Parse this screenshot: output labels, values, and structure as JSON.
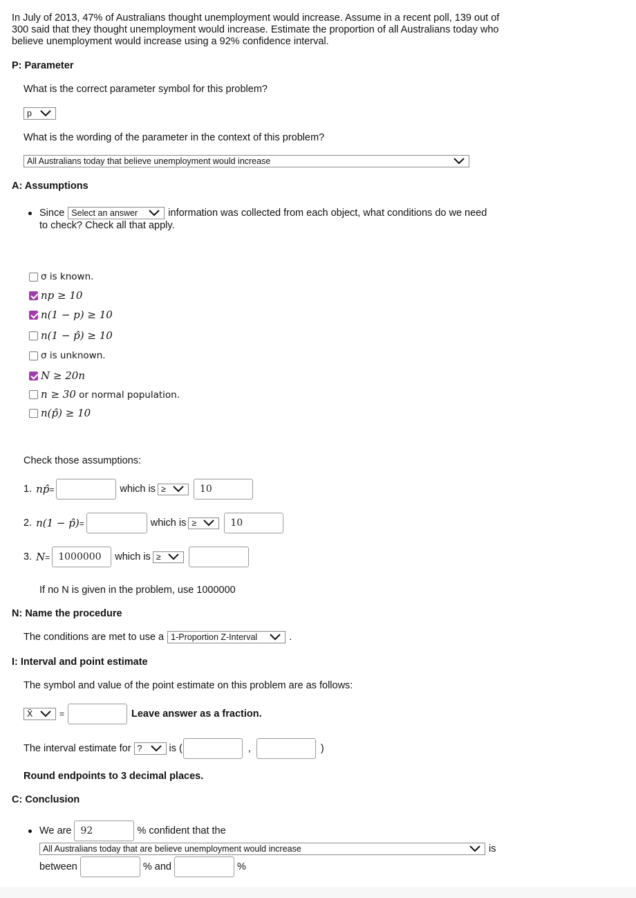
{
  "problem": {
    "text": "In July of 2013, 47% of Australians thought unemployment would increase.  Assume in a recent poll, 139 out of 300 said that they thought unemployment would increase.  Estimate the proportion of all Australians today who believe unemployment would increase using a 92% confidence interval."
  },
  "parameter": {
    "heading": "P: Parameter",
    "symbol_question": "What is the correct parameter symbol for this problem?",
    "symbol_value": "p",
    "wording_question": "What is the wording of the parameter in the context of this problem?",
    "wording_value": "All Australians today that believe unemployment would increase"
  },
  "assumptions": {
    "heading": "A: Assumptions",
    "since_prefix": "Since",
    "since_select": "Select an answer",
    "since_suffix": "information was collected from each object, what conditions do we need",
    "since_line2": "to check?  Check all that apply.",
    "options": [
      {
        "label": "σ is known.",
        "checked": false
      },
      {
        "label": "np ≥ 10",
        "checked": true
      },
      {
        "label": "n(1 − p) ≥ 10",
        "checked": true
      },
      {
        "label": "n(1 − p̂) ≥ 10",
        "checked": false
      },
      {
        "label": "σ is unknown.",
        "checked": false
      },
      {
        "label": "N ≥ 20n",
        "checked": true
      },
      {
        "label": "n ≥ 30 or normal population.",
        "checked": false
      },
      {
        "label": "n(p̂) ≥ 10",
        "checked": false
      }
    ],
    "check_heading": "Check those assumptions:",
    "checks": [
      {
        "num": "1.",
        "expr": "np̂=",
        "value": "",
        "which_is": "which is",
        "comparator": "≥",
        "compare_value": "10"
      },
      {
        "num": "2.",
        "expr": "n(1 − p̂)=",
        "value": "",
        "which_is": "which is",
        "comparator": "≥",
        "compare_value": "10"
      },
      {
        "num": "3.",
        "expr": "N=",
        "value": "1000000",
        "which_is": "which is",
        "comparator": "≥",
        "compare_value": ""
      }
    ],
    "n_note": "If no N is given in the problem, use 1000000"
  },
  "name": {
    "heading": "N: Name the procedure",
    "prefix": "The conditions are met to use a",
    "procedure": "1-Proportion Z-Interval",
    "suffix": "."
  },
  "interval": {
    "heading": "I: Interval and point estimate",
    "symbol_text": "The symbol and value of the point estimate on this problem are as follows:",
    "point_symbol": "X̄",
    "equals": "=",
    "point_value": "",
    "fraction_note": "Leave answer as a fraction.",
    "interval_prefix": "The interval estimate for",
    "interval_symbol": "?",
    "interval_is": "is (",
    "comma": ",",
    "close": ")",
    "lower": "",
    "upper": "",
    "round_note": "Round endpoints to 3 decimal places."
  },
  "conclusion": {
    "heading": "C: Conclusion",
    "we_are": "We are",
    "confidence": "92",
    "confident_text": "% confident that the",
    "parameter_select": "All Australians today that are believe unemployment would increase",
    "is": "is",
    "between": "between",
    "lower": "",
    "and": "% and",
    "upper": "",
    "pct": "%"
  }
}
